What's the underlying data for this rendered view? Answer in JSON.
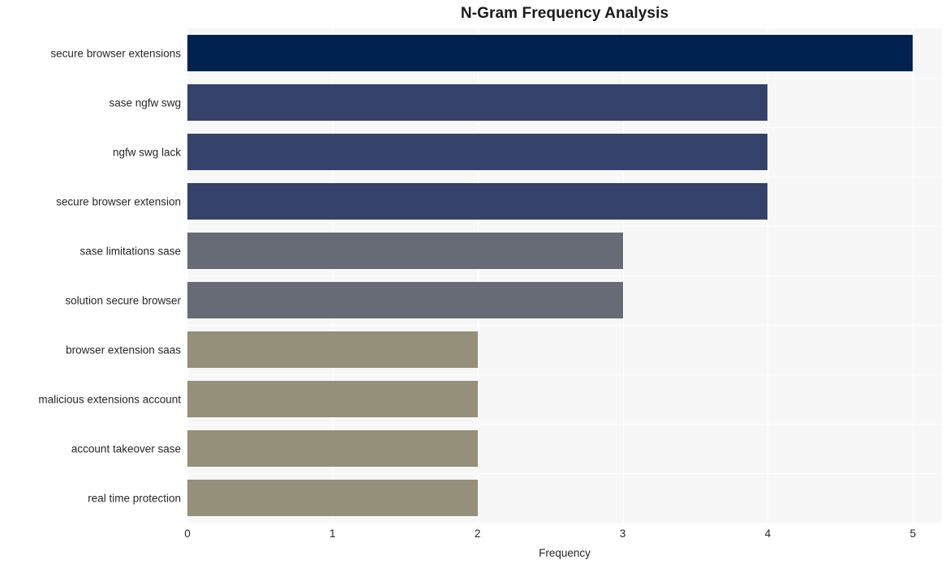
{
  "chart_data": {
    "type": "bar",
    "orientation": "horizontal",
    "title": "N-Gram Frequency Analysis",
    "xlabel": "Frequency",
    "ylabel": "",
    "xlim": [
      0,
      5.2
    ],
    "xticks": [
      0,
      1,
      2,
      3,
      4,
      5
    ],
    "xtick_labels": [
      "0",
      "1",
      "2",
      "3",
      "4",
      "5"
    ],
    "grid": true,
    "legend": false,
    "categories": [
      "secure browser extensions",
      "sase ngfw swg",
      "ngfw swg lack",
      "secure browser extension",
      "sase limitations sase",
      "solution secure browser",
      "browser extension saas",
      "malicious extensions account",
      "account takeover sase",
      "real time protection"
    ],
    "values": [
      5,
      4,
      4,
      4,
      3,
      3,
      2,
      2,
      2,
      2
    ],
    "bar_colors": [
      "#002250",
      "#35426b",
      "#35426b",
      "#35426b",
      "#676b76",
      "#676b76",
      "#949079",
      "#949079",
      "#949079",
      "#949079"
    ],
    "plot_background": "#f7f7f7",
    "gridline_color": "#ffffff",
    "figure_background": "#ffffff",
    "text_color": "#262626"
  }
}
